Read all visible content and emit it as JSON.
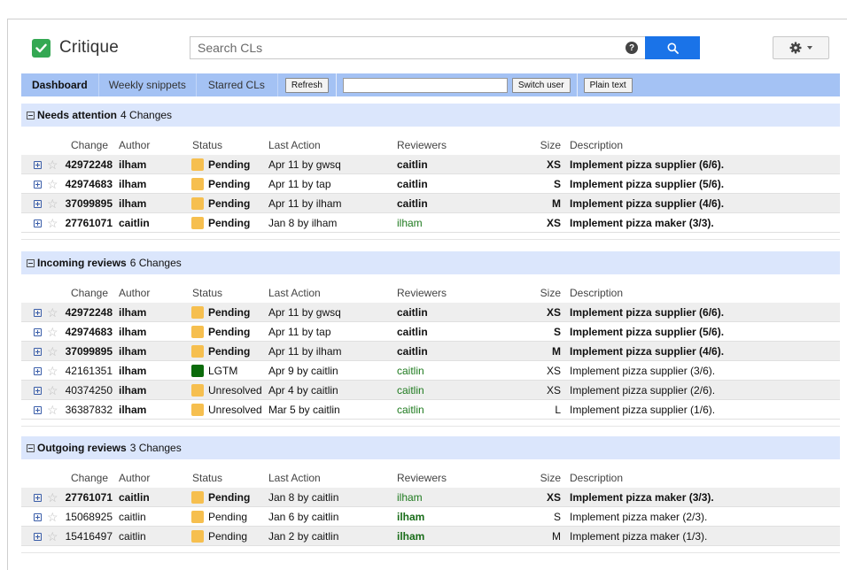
{
  "app": {
    "title": "Critique",
    "search_placeholder": "Search CLs",
    "help_glyph": "?"
  },
  "nav": {
    "tabs": [
      "Dashboard",
      "Weekly snippets",
      "Starred CLs"
    ],
    "active_tab": "Dashboard",
    "refresh_label": "Refresh",
    "user_field_value": "",
    "switch_user_label": "Switch user",
    "plain_text_label": "Plain text"
  },
  "columns": {
    "change": "Change",
    "author": "Author",
    "status": "Status",
    "last_action": "Last Action",
    "reviewers": "Reviewers",
    "size": "Size",
    "description": "Description"
  },
  "colors": {
    "pending": "#f6bf4f",
    "lgtm": "#0b6b0b",
    "unresolved": "#f6bf4f",
    "nav_bar": "#a4c2f4",
    "section_header": "#dbe6fc",
    "search_button": "#1a73e8",
    "logo": "#34a853"
  },
  "icons": {
    "logo": "checkmark-icon",
    "help": "help-icon",
    "search": "magnifier-icon",
    "settings": "gear-icon",
    "expand": "plus-box-icon",
    "star": "star-outline-icon",
    "collapse": "minus-box-icon"
  },
  "sections": [
    {
      "title": "Needs attention",
      "count": "4 Changes",
      "rows": [
        {
          "change": "42972248",
          "author": "ilham",
          "status": "Pending",
          "swatch": "pending",
          "last_action": "Apr 11 by gwsq",
          "reviewers": "caitlin",
          "size": "XS",
          "description": "Implement pizza supplier (6/6).",
          "bold_row": true,
          "bold_author": false,
          "reviewer_style": "bold"
        },
        {
          "change": "42974683",
          "author": "ilham",
          "status": "Pending",
          "swatch": "pending",
          "last_action": "Apr 11 by tap",
          "reviewers": "caitlin",
          "size": "S",
          "description": "Implement pizza supplier (5/6).",
          "bold_row": true,
          "bold_author": false,
          "reviewer_style": "bold"
        },
        {
          "change": "37099895",
          "author": "ilham",
          "status": "Pending",
          "swatch": "pending",
          "last_action": "Apr 11 by ilham",
          "reviewers": "caitlin",
          "size": "M",
          "description": "Implement pizza supplier (4/6).",
          "bold_row": true,
          "bold_author": false,
          "reviewer_style": "bold"
        },
        {
          "change": "27761071",
          "author": "caitlin",
          "status": "Pending",
          "swatch": "pending",
          "last_action": "Jan 8 by ilham",
          "reviewers": "ilham",
          "size": "XS",
          "description": "Implement pizza maker (3/3).",
          "bold_row": true,
          "bold_author": true,
          "reviewer_style": "green"
        }
      ]
    },
    {
      "title": "Incoming reviews",
      "count": "6 Changes",
      "rows": [
        {
          "change": "42972248",
          "author": "ilham",
          "status": "Pending",
          "swatch": "pending",
          "last_action": "Apr 11 by gwsq",
          "reviewers": "caitlin",
          "size": "XS",
          "description": "Implement pizza supplier (6/6).",
          "bold_row": true,
          "bold_author": false,
          "reviewer_style": "bold"
        },
        {
          "change": "42974683",
          "author": "ilham",
          "status": "Pending",
          "swatch": "pending",
          "last_action": "Apr 11 by tap",
          "reviewers": "caitlin",
          "size": "S",
          "description": "Implement pizza supplier (5/6).",
          "bold_row": true,
          "bold_author": false,
          "reviewer_style": "bold"
        },
        {
          "change": "37099895",
          "author": "ilham",
          "status": "Pending",
          "swatch": "pending",
          "last_action": "Apr 11 by ilham",
          "reviewers": "caitlin",
          "size": "M",
          "description": "Implement pizza supplier (4/6).",
          "bold_row": true,
          "bold_author": false,
          "reviewer_style": "bold"
        },
        {
          "change": "42161351",
          "author": "ilham",
          "status": "LGTM",
          "swatch": "lgtm",
          "last_action": "Apr 9 by caitlin",
          "reviewers": "caitlin",
          "size": "XS",
          "description": "Implement pizza supplier (3/6).",
          "bold_row": false,
          "bold_author": true,
          "reviewer_style": "green"
        },
        {
          "change": "40374250",
          "author": "ilham",
          "status": "Unresolved",
          "swatch": "unresolved",
          "last_action": "Apr 4 by caitlin",
          "reviewers": "caitlin",
          "size": "XS",
          "description": "Implement pizza supplier (2/6).",
          "bold_row": false,
          "bold_author": true,
          "reviewer_style": "green"
        },
        {
          "change": "36387832",
          "author": "ilham",
          "status": "Unresolved",
          "swatch": "unresolved",
          "last_action": "Mar 5 by caitlin",
          "reviewers": "caitlin",
          "size": "L",
          "description": "Implement pizza supplier (1/6).",
          "bold_row": false,
          "bold_author": true,
          "reviewer_style": "green"
        }
      ]
    },
    {
      "title": "Outgoing reviews",
      "count": "3 Changes",
      "rows": [
        {
          "change": "27761071",
          "author": "caitlin",
          "status": "Pending",
          "swatch": "pending",
          "last_action": "Jan 8 by caitlin",
          "reviewers": "ilham",
          "size": "XS",
          "description": "Implement pizza maker (3/3).",
          "bold_row": true,
          "bold_author": true,
          "reviewer_style": "green"
        },
        {
          "change": "15068925",
          "author": "caitlin",
          "status": "Pending",
          "swatch": "pending",
          "last_action": "Jan 6 by caitlin",
          "reviewers": "ilham",
          "size": "S",
          "description": "Implement pizza maker (2/3).",
          "bold_row": false,
          "bold_author": false,
          "reviewer_style": "green-bold"
        },
        {
          "change": "15416497",
          "author": "caitlin",
          "status": "Pending",
          "swatch": "pending",
          "last_action": "Jan 2 by caitlin",
          "reviewers": "ilham",
          "size": "M",
          "description": "Implement pizza maker (1/3).",
          "bold_row": false,
          "bold_author": false,
          "reviewer_style": "green-bold"
        }
      ]
    }
  ]
}
